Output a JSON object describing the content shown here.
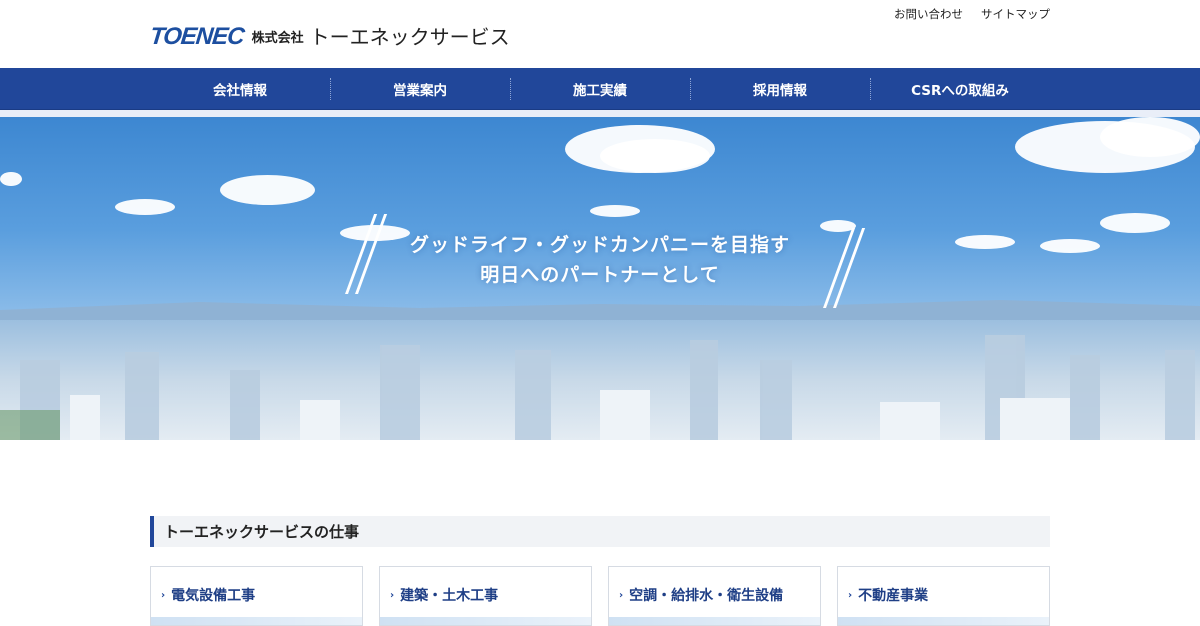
{
  "header": {
    "logo_mark": "TOENEC",
    "logo_kabushiki": "株式会社",
    "logo_name": "トーエネックサービス",
    "util_links": [
      "お問い合わせ",
      "サイトマップ"
    ]
  },
  "nav": {
    "items": [
      "会社情報",
      "営業案内",
      "施工実績",
      "採用情報",
      "CSRへの取組み"
    ]
  },
  "hero": {
    "line1": "グッドライフ・グッドカンパニーを目指す",
    "line2": "明日へのパートナーとして"
  },
  "section": {
    "title": "トーエネックサービスの仕事",
    "cards": [
      "電気設備工事",
      "建築・土木工事",
      "空調・給排水・衛生設備",
      "不動産事業"
    ]
  },
  "colors": {
    "brand": "#21479a",
    "accent_text": "#1f3f86"
  }
}
